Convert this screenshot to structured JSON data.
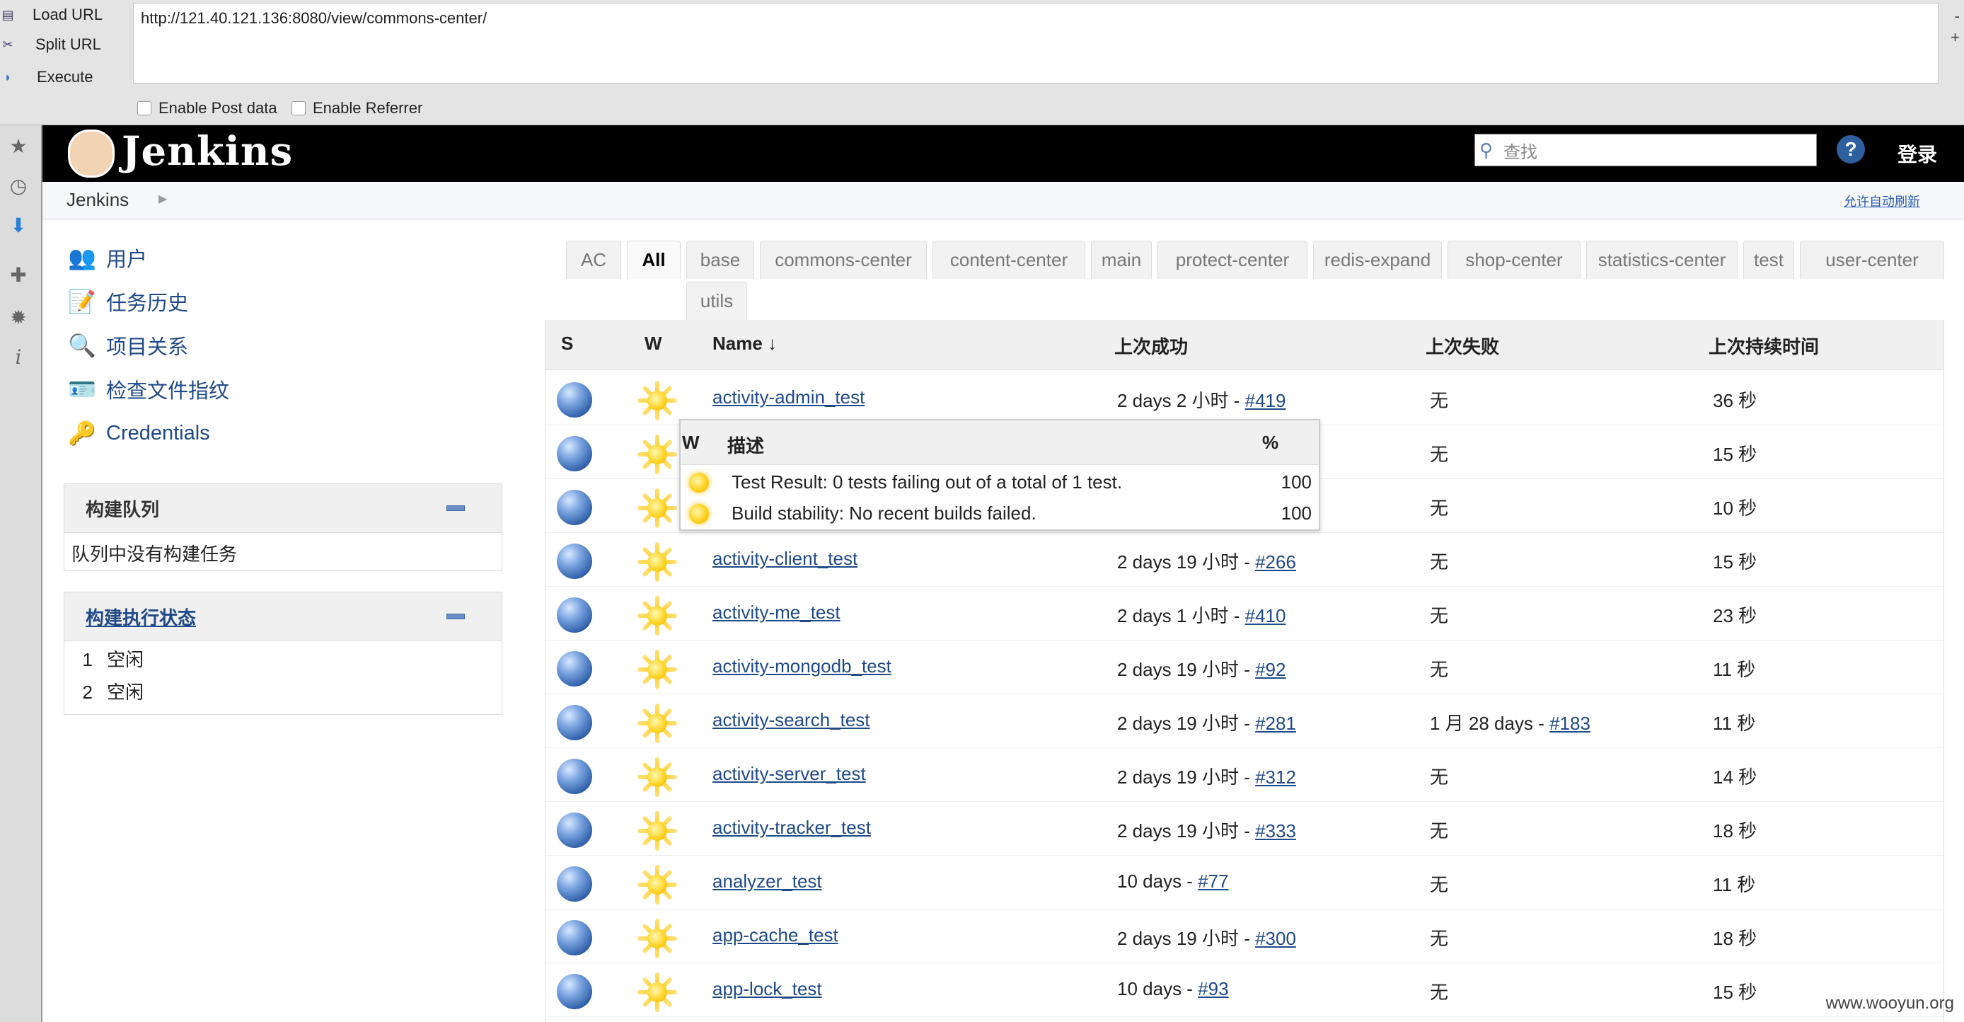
{
  "hackbar": {
    "load_url": "Load URL",
    "split_url": "Split URL",
    "execute": "Execute",
    "url_value": "http://121.40.121.136:8080/view/commons-center/",
    "enable_post": "Enable Post data",
    "enable_referrer": "Enable Referrer",
    "right_symbols": [
      "-",
      "+"
    ]
  },
  "header": {
    "logo_text": "Jenkins",
    "search_placeholder": "查找",
    "help": "?",
    "login": "登录"
  },
  "breadcrumb": {
    "root": "Jenkins",
    "auto_refresh": "允许自动刷新"
  },
  "tasks": [
    {
      "label": "用户",
      "icon": "users-icon"
    },
    {
      "label": "任务历史",
      "icon": "notepad-icon"
    },
    {
      "label": "项目关系",
      "icon": "magnifier-icon"
    },
    {
      "label": "检查文件指纹",
      "icon": "fingerprint-card-icon"
    },
    {
      "label": "Credentials",
      "icon": "keys-icon"
    }
  ],
  "build_queue": {
    "title": "构建队列",
    "empty": "队列中没有构建任务"
  },
  "executors": {
    "title": "构建执行状态",
    "rows": [
      {
        "num": "1",
        "state": "空闲"
      },
      {
        "num": "2",
        "state": "空闲"
      }
    ]
  },
  "tabs": [
    "AC",
    "All",
    "base",
    "commons-center",
    "content-center",
    "main",
    "protect-center",
    "redis-expand",
    "shop-center",
    "statistics-center",
    "test",
    "user-center",
    "utils"
  ],
  "active_tab": "All",
  "table": {
    "headers": {
      "s": "S",
      "w": "W",
      "name": "Name ↓",
      "last_success": "上次成功",
      "last_failure": "上次失败",
      "last_duration": "上次持续时间"
    },
    "rows": [
      {
        "name": "activity-admin_test",
        "success_text": "2 days 2 小时 - ",
        "success_link": "#419",
        "failure_text": "无",
        "failure_link": "",
        "duration": "36 秒"
      },
      {
        "name": "",
        "success_text": "",
        "success_link": "",
        "failure_text": "无",
        "failure_link": "",
        "duration": "15 秒"
      },
      {
        "name": "",
        "success_text": "",
        "success_link": "",
        "failure_text": "无",
        "failure_link": "",
        "duration": "10 秒"
      },
      {
        "name": "activity-client_test",
        "success_text": "2 days 19 小时 - ",
        "success_link": "#266",
        "failure_text": "无",
        "failure_link": "",
        "duration": "15 秒"
      },
      {
        "name": "activity-me_test",
        "success_text": "2 days 1 小时 - ",
        "success_link": "#410",
        "failure_text": "无",
        "failure_link": "",
        "duration": "23 秒"
      },
      {
        "name": "activity-mongodb_test",
        "success_text": "2 days 19 小时 - ",
        "success_link": "#92",
        "failure_text": "无",
        "failure_link": "",
        "duration": "11 秒"
      },
      {
        "name": "activity-search_test",
        "success_text": "2 days 19 小时 - ",
        "success_link": "#281",
        "failure_text": "1 月 28 days - ",
        "failure_link": "#183",
        "duration": "11 秒"
      },
      {
        "name": "activity-server_test",
        "success_text": "2 days 19 小时 - ",
        "success_link": "#312",
        "failure_text": "无",
        "failure_link": "",
        "duration": "14 秒"
      },
      {
        "name": "activity-tracker_test",
        "success_text": "2 days 19 小时 - ",
        "success_link": "#333",
        "failure_text": "无",
        "failure_link": "",
        "duration": "18 秒"
      },
      {
        "name": "analyzer_test",
        "success_text": "10 days - ",
        "success_link": "#77",
        "failure_text": "无",
        "failure_link": "",
        "duration": "11 秒"
      },
      {
        "name": "app-cache_test",
        "success_text": "2 days 19 小时 - ",
        "success_link": "#300",
        "failure_text": "无",
        "failure_link": "",
        "duration": "18 秒"
      },
      {
        "name": "app-lock_test",
        "success_text": "10 days - ",
        "success_link": "#93",
        "failure_text": "无",
        "failure_link": "",
        "duration": "15 秒"
      }
    ]
  },
  "tooltip": {
    "col_w": "W",
    "col_desc": "描述",
    "col_pct": "%",
    "rows": [
      {
        "desc": "Test Result: 0 tests failing out of a total of 1 test.",
        "pct": "100"
      },
      {
        "desc": "Build stability: No recent builds failed.",
        "pct": "100"
      }
    ]
  },
  "watermark": "www.wooyun.org",
  "colors": {
    "link": "#204a87",
    "header_bg": "#000000",
    "ball": "#2f5fa8",
    "sun": "#ffd21f"
  }
}
